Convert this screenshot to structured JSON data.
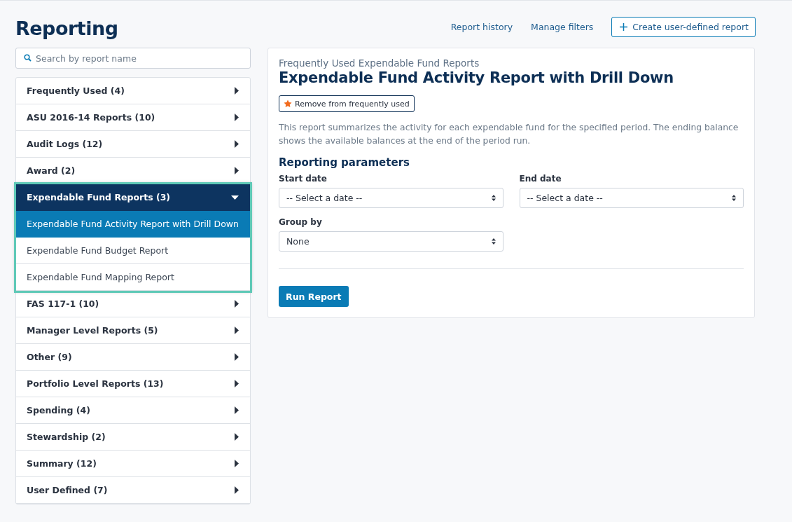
{
  "page": {
    "title": "Reporting"
  },
  "header_links": [
    {
      "label": "Report history",
      "kind": "link"
    },
    {
      "label": "Manage filters",
      "kind": "link"
    },
    {
      "label": "Create user-defined report",
      "kind": "button"
    }
  ],
  "search": {
    "placeholder": "Search by report name"
  },
  "categories": [
    {
      "label": "Frequently Used (4)",
      "expanded": false,
      "highlighted": false
    },
    {
      "label": "ASU 2016-14 Reports (10)",
      "expanded": false,
      "highlighted": false
    },
    {
      "label": "Audit Logs (12)",
      "expanded": false,
      "highlighted": false
    },
    {
      "label": "Award (2)",
      "expanded": false,
      "highlighted": false
    },
    {
      "label": "Expendable Fund Reports (3)",
      "expanded": true,
      "highlighted": true,
      "children": [
        {
          "label": "Expendable Fund Activity Report with Drill Down",
          "selected": true
        },
        {
          "label": "Expendable Fund Budget Report",
          "selected": false
        },
        {
          "label": "Expendable Fund Mapping Report",
          "selected": false
        }
      ]
    },
    {
      "label": "FAS 117-1 (10)",
      "expanded": false,
      "highlighted": false
    },
    {
      "label": "Manager Level Reports (5)",
      "expanded": false,
      "highlighted": false
    },
    {
      "label": "Other (9)",
      "expanded": false,
      "highlighted": false
    },
    {
      "label": "Portfolio Level Reports (13)",
      "expanded": false,
      "highlighted": false
    },
    {
      "label": "Spending (4)",
      "expanded": false,
      "highlighted": false
    },
    {
      "label": "Stewardship (2)",
      "expanded": false,
      "highlighted": false
    },
    {
      "label": "Summary (12)",
      "expanded": false,
      "highlighted": false
    },
    {
      "label": "User Defined (7)",
      "expanded": false,
      "highlighted": false
    }
  ],
  "report": {
    "category": "Frequently Used Expendable Fund Reports",
    "title": "Expendable Fund Activity Report with Drill Down",
    "favorite_button": "Remove from frequently used",
    "description": "This report summarizes the activity for each expendable fund for the specified period. The ending balance shows the available balances at the end of the period run.",
    "parameters_heading": "Reporting parameters",
    "fields": [
      {
        "label": "Start date",
        "value": "-- Select a date --"
      },
      {
        "label": "End date",
        "value": "-- Select a date --"
      },
      {
        "label": "Group by",
        "value": "None"
      }
    ],
    "run_button": "Run Report"
  }
}
